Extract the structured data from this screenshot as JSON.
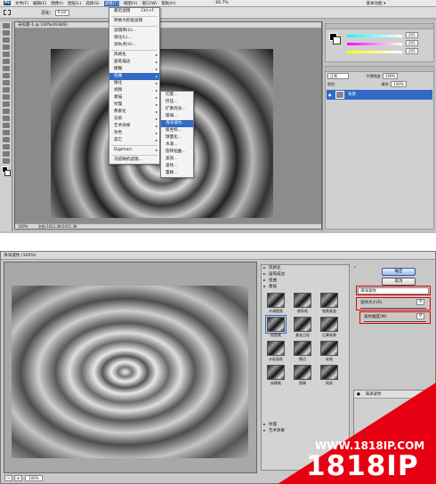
{
  "ps": {
    "menubar": [
      "文件(F)",
      "编辑(E)",
      "图像(I)",
      "图层(L)",
      "选择(S)",
      "滤镜(T)",
      "视图(V)",
      "窗口(W)",
      "帮助(H)"
    ],
    "zoom": "66.7%",
    "workspace": "基本功能 ▾",
    "options": {
      "feather_label": "羽化:",
      "feather_value": "0 px"
    },
    "doc_title": "未标题-1 @ 100%(RGB/8)",
    "doc_status": {
      "zoom": "100%",
      "info": "文档:1011.3K/1011.3K"
    },
    "filter_menu": {
      "items": [
        {
          "label": "最近滤镜",
          "shortcut": "Ctrl+F"
        },
        {
          "label": "转换为智能滤镜"
        },
        {
          "label": "滤镜库(G)..."
        },
        {
          "label": "液化(L)..."
        },
        {
          "label": "消失点(V)..."
        },
        {
          "label": "风格化",
          "sub": true
        },
        {
          "label": "画笔描边",
          "sub": true
        },
        {
          "label": "模糊",
          "sub": true
        },
        {
          "label": "扭曲",
          "sub": true,
          "selected": true
        },
        {
          "label": "锐化",
          "sub": true
        },
        {
          "label": "视频",
          "sub": true
        },
        {
          "label": "素描",
          "sub": true
        },
        {
          "label": "纹理",
          "sub": true
        },
        {
          "label": "像素化",
          "sub": true
        },
        {
          "label": "渲染",
          "sub": true
        },
        {
          "label": "艺术效果",
          "sub": true
        },
        {
          "label": "杂色",
          "sub": true
        },
        {
          "label": "其它",
          "sub": true
        },
        {
          "label": "Digimarc",
          "sub": true
        },
        {
          "label": "浏览联机滤镜..."
        }
      ],
      "submenu": [
        {
          "label": "切变..."
        },
        {
          "label": "挤压..."
        },
        {
          "label": "扩散亮光..."
        },
        {
          "label": "玻璃..."
        },
        {
          "label": "海洋波纹...",
          "selected": true
        },
        {
          "label": "极坐标..."
        },
        {
          "label": "球面化..."
        },
        {
          "label": "水波..."
        },
        {
          "label": "旋转扭曲..."
        },
        {
          "label": "波浪..."
        },
        {
          "label": "波纹..."
        },
        {
          "label": "置换..."
        }
      ]
    },
    "color_panel": {
      "r": "255",
      "g": "255",
      "b": "255"
    },
    "layers_panel": {
      "blend_mode": "正常",
      "opacity_label": "不透明度:",
      "opacity_value": "100%",
      "fill_label": "填充:",
      "fill_value": "100%",
      "lock_label": "锁定:",
      "layer_name": "背景"
    }
  },
  "dialog": {
    "title": "海洋波纹 (100%)",
    "zoom": "100%",
    "groups": [
      "风格化",
      "画笔描边",
      "扭曲",
      "素描",
      "纹理",
      "艺术效果"
    ],
    "thumbnails": [
      "半调图案",
      "便条纸",
      "铬黄渐变",
      "绘图笔",
      "基底凸现",
      "石膏效果",
      "水彩画纸",
      "撕边",
      "炭笔",
      "炭精笔",
      "图章",
      "网状"
    ],
    "ok": "确定",
    "cancel": "取消",
    "filter_select": "海洋波纹",
    "param1_label": "波纹大小(R)",
    "param1_value": "9",
    "param2_label": "波纹幅度(M)",
    "param2_value": "9",
    "layer_item": "海洋波纹"
  },
  "watermark": {
    "url": "WWW.1818IP.COM",
    "brand": "1818IP"
  }
}
